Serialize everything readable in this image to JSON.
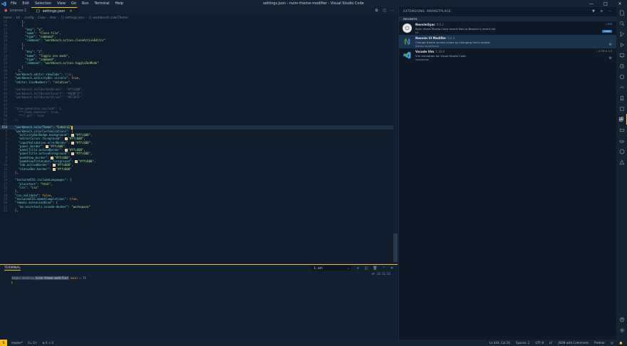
{
  "titlebar": {
    "menu": [
      "File",
      "Edit",
      "Selection",
      "View",
      "Go",
      "Run",
      "Terminal",
      "Help"
    ],
    "title": "settings.json - nvim-theme-modifier - Visual Studio Code"
  },
  "tabs": [
    {
      "label": "License-1",
      "active": false
    },
    {
      "label": "settings.json",
      "active": true
    }
  ],
  "breadcrumb": [
    "home",
    "kd",
    ".config",
    "Code",
    "User",
    "{} settings.json",
    "{} workbench.colorTheme"
  ],
  "code_lines": [
    {
      "n": "25",
      "html": "      },"
    },
    {
      "n": "26",
      "html": "      {"
    },
    {
      "n": "27",
      "html": "        <span class='k'>\"key\"</span>: <span class='s'>\"x\"</span>,"
    },
    {
      "n": "28",
      "html": "        <span class='k'>\"name\"</span>: <span class='s'>\"Close file\"</span>,"
    },
    {
      "n": "29",
      "html": "        <span class='k'>\"type\"</span>: <span class='s'>\"command\"</span>,"
    },
    {
      "n": "30",
      "html": "        <span class='k'>\"command\"</span>: <span class='s'>\"workbench.action.closeActiveEditor\"</span>"
    },
    {
      "n": "31",
      "html": "      },"
    },
    {
      "n": "32",
      "html": "      {"
    },
    {
      "n": "33",
      "html": "        <span class='k'>\"key\"</span>: <span class='s'>\"z\"</span>,"
    },
    {
      "n": "34",
      "html": "        <span class='k'>\"name\"</span>: <span class='s'>\"Toggle zen mode\"</span>,"
    },
    {
      "n": "35",
      "html": "        <span class='k'>\"type\"</span>: <span class='s'>\"command\"</span>,"
    },
    {
      "n": "36",
      "html": "        <span class='k'>\"command\"</span>: <span class='s'>\"workbench.action.toggleZenMode\"</span>"
    },
    {
      "n": "37",
      "html": "      }"
    },
    {
      "n": "38",
      "html": "    ],"
    },
    {
      "n": "39",
      "html": "  <span class='k'>\"workbench.editor.showTabs\"</span>: <span class='c'>true</span>,"
    },
    {
      "n": "40",
      "html": "  <span class='k'>\"workbench.activityBar.visible\"</span>: <span class='p'>true</span>,"
    },
    {
      "n": "41",
      "html": "  <span class='k'>\"editor.lineNumbers\"</span>: <span class='s'>\"relative\"</span>,"
    },
    {
      "n": "42",
      "html": ""
    },
    {
      "n": "43",
      "html": "  <span class='c'>\"workbench.tellBorderNormal\": \"#ffc600\",</span>"
    },
    {
      "n": "44",
      "html": "  <span class='c'>\"workbench.tellBorderInsert\": \"#6DBF2F\",</span>"
    },
    {
      "n": "45",
      "html": "  <span class='c'>\"workbench.tellBorderVisual\": \"#D7365F\",</span>"
    },
    {
      "n": "46",
      "html": ""
    },
    {
      "n": "47",
      "html": ""
    },
    {
      "n": "48",
      "html": "  <span class='c'>\"tree-generator.exclude\": [</span>"
    },
    {
      "n": "49",
      "html": "    <span class='c'>\"**/node_modules\": true,</span>"
    },
    {
      "n": "50",
      "html": "    <span class='c'>\"**/.git\": true</span>"
    },
    {
      "n": "51",
      "html": "  <span class='c'>},</span>"
    },
    {
      "n": "52",
      "html": ""
    },
    {
      "n": "E50",
      "html": "  <span class='k'>\"workbench.colorTheme\"</span>: <span class='s'>\"Cobalt2\"</span><span class='cursor'></span>",
      "cur": true
    },
    {
      "n": "1",
      "html": "  <span class='k'>\"workbench.colorCustomizations\"</span>: {"
    },
    {
      "n": "2",
      "html": "    <span class='k'>\"activityBarBadge.background\"</span>: <span class='swatch'></span><span class='s'>\"#ffc600\"</span>,"
    },
    {
      "n": "3",
      "html": "    <span class='k'>\"editorCursor.foreground\"</span>: <span class='swatch'></span><span class='s'>\"#ffc600\"</span>,"
    },
    {
      "n": "4",
      "html": "    <span class='k'>\"inputValidation.errorBorder\"</span>: <span class='swatch'></span><span class='s'>\"#ffc600\"</span>,"
    },
    {
      "n": "5",
      "html": "    <span class='k'>\"panel.border\"</span>: <span class='swatch'></span><span class='s'>\"#ffc600\"</span>,"
    },
    {
      "n": "6",
      "html": "    <span class='k'>\"panelTitle.activeBorder\"</span>: <span class='swatch'></span><span class='s'>\"#ffc600\"</span>,"
    },
    {
      "n": "7",
      "html": "    <span class='k'>\"panelTitle.activeForeground\"</span>: <span class='swatch'></span><span class='s'>\"#ffc600\"</span>,"
    },
    {
      "n": "8",
      "html": "    <span class='k'>\"peekView.border\"</span>: <span class='swatch'></span><span class='s'>\"#ffc600\"</span>,"
    },
    {
      "n": "9",
      "html": "    <span class='k'>\"peekViewTitleLabel.foreground\"</span>: <span class='swatch'></span><span class='s'>\"#ffc600\"</span>,"
    },
    {
      "n": "10",
      "html": "    <span class='k'>\"tab.activeBorder\"</span>: <span class='swatch'></span><span class='s'>\"#ffc600\"</span>,"
    },
    {
      "n": "11",
      "html": "    <span class='k'>\"statusBar.border\"</span>: <span class='swatch'></span><span class='s'>\"#ffc600\"</span>"
    },
    {
      "n": "12",
      "html": "  },"
    },
    {
      "n": "13",
      "html": ""
    },
    {
      "n": "14",
      "html": "  <span class='k'>\"tailwindCSS.includeLanguages\"</span>: {"
    },
    {
      "n": "15",
      "html": "    <span class='k'>\"plaintext\"</span>: <span class='s'>\"html\"</span>,"
    },
    {
      "n": "16",
      "html": "    <span class='k'>\"css\"</span>: <span class='s'>\"css\"</span>"
    },
    {
      "n": "17",
      "html": "  },"
    },
    {
      "n": "18",
      "html": "  <span class='k'>\"css.validate\"</span>: <span class='b'>false</span>,"
    },
    {
      "n": "19",
      "html": "  <span class='k'>\"tailwindCSS.emmetCompletions\"</span>: <span class='b'>true</span>,"
    },
    {
      "n": "20",
      "html": "  <span class='k'>\"remote.extensionKind\"</span>: {"
    },
    {
      "n": "21",
      "html": "    <span class='k'>\"ms-azuretools.vscode-docker\"</span>: <span class='s'>\"workspace\"</span>"
    },
    {
      "n": "22",
      "html": "  },"
    }
  ],
  "panel": {
    "title": "TERMINAL",
    "shell_select": "1: zsh",
    "prompt_user": "kd@kd-desktop",
    "prompt_dir": "nvim-theme-modifier",
    "prompt_git": "main ☐ ?1",
    "time": "at 13:11:22"
  },
  "statusbar": {
    "branch": "master*",
    "sync": "0↓ 0↑",
    "problems": "⊗ 0 ⚠ 0",
    "position": "Ln 444, Col 26",
    "spaces": "Spaces: 2",
    "encoding": "UTF-8",
    "eol": "LF",
    "language": "JSON with Comments",
    "formatter": "Prettier"
  },
  "sidebar": {
    "title": "EXTENSIONS: MARKETPLACE",
    "section": "RECENTS",
    "extensions": [
      {
        "name": "NeovimSync",
        "version": "0.0.2",
        "desc": "Sync Visual Studio Code recent files to Neovim's recent list",
        "publisher": "kd",
        "meta": "⤓ 493",
        "button": "Install",
        "selected": false
      },
      {
        "name": "Neovim UI Modifier",
        "version": "0.0.3",
        "desc": "Change theme accent colors by changing Vim's modes",
        "publisher": "Kishan Jayashandi",
        "meta": "",
        "button": "",
        "selected": true
      },
      {
        "name": "Vscode Vim",
        "version": "1.16.0",
        "desc": "Vim emulation for Visual Studio Code",
        "publisher": "vscodevim",
        "meta": "⤓ 3.7M ★ 4.5",
        "button": "",
        "selected": false
      }
    ]
  }
}
